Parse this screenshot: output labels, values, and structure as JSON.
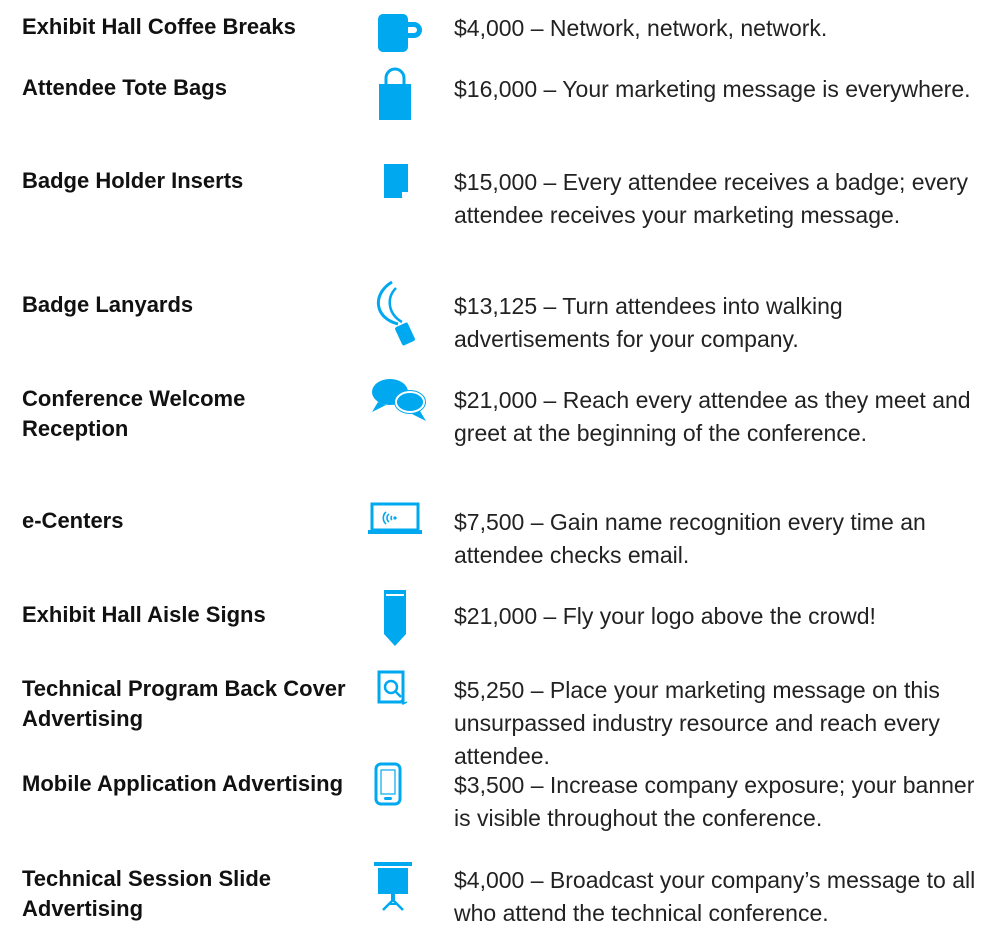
{
  "accent_color": "#00a8f0",
  "items": [
    {
      "title": "Exhibit Hall Coffee Breaks",
      "icon": "coffee-mug-icon",
      "description": "$4,000 – Network, network, network."
    },
    {
      "title": "Attendee Tote Bags",
      "icon": "tote-bag-icon",
      "description": "$16,000 – Your marketing message is everywhere."
    },
    {
      "title": "Badge Holder Inserts",
      "icon": "badge-insert-icon",
      "description": "$15,000 – Every attendee receives a badge; every attendee receives your marketing message."
    },
    {
      "title": "Badge Lanyards",
      "icon": "lanyard-icon",
      "description": "$13,125 – Turn attendees into walking advertisements for your company."
    },
    {
      "title": "Conference Welcome Reception",
      "icon": "speech-bubbles-icon",
      "description": "$21,000 – Reach every attendee as they meet and greet at the beginning of the conference."
    },
    {
      "title": "e-Centers",
      "icon": "laptop-wifi-icon",
      "description": "$7,500 – Gain name recognition every time an attendee checks email."
    },
    {
      "title": "Exhibit Hall Aisle Signs",
      "icon": "aisle-sign-icon",
      "description": "$21,000 – Fly your logo above the crowd!"
    },
    {
      "title": "Technical Program Back Cover Advertising",
      "icon": "program-book-icon",
      "description": "$5,250 – Place your marketing message on this unsurpassed industry resource and reach every attendee."
    },
    {
      "title": "Mobile Application Advertising",
      "icon": "mobile-phone-icon",
      "description": "$3,500 – Increase company exposure; your banner is visible throughout the conference."
    },
    {
      "title": "Technical Session Slide Advertising",
      "icon": "projector-screen-icon",
      "description": "$4,000 – Broadcast your company’s message to all who attend the    technical conference."
    }
  ]
}
